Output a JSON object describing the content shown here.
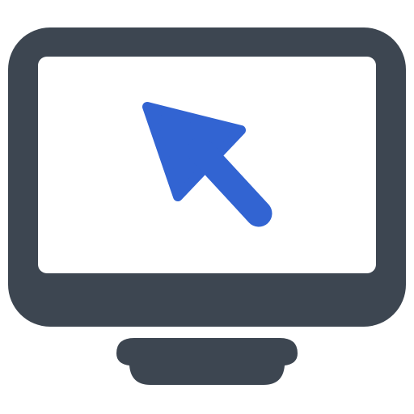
{
  "icon": {
    "name": "computer-monitor-cursor-icon",
    "colors": {
      "frame": "#3d4651",
      "screen": "#ffffff",
      "cursor": "#3264d2",
      "background": "#ffffff"
    }
  }
}
